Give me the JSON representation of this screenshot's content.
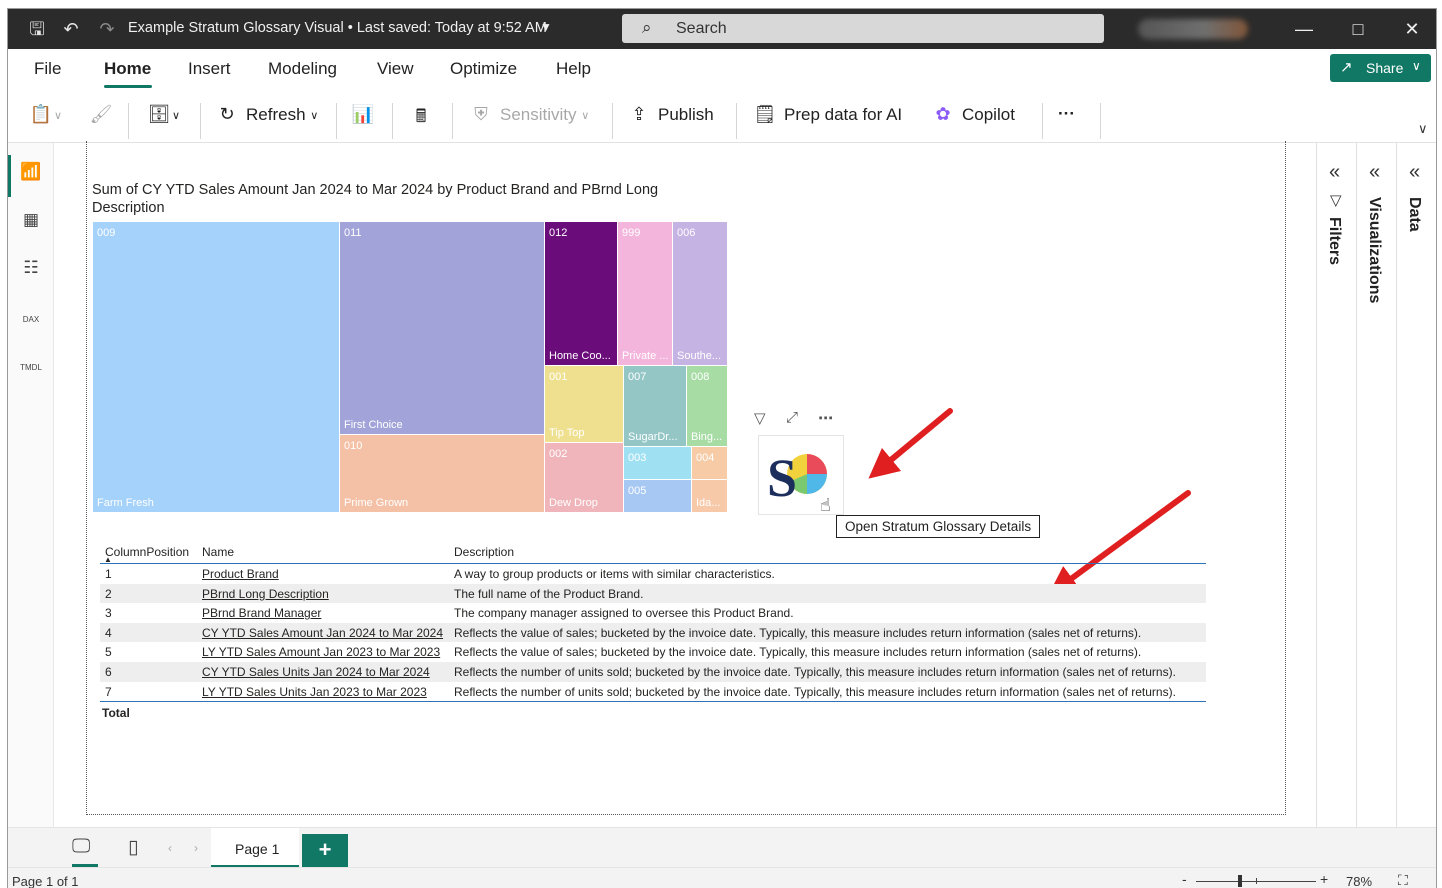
{
  "titlebar": {
    "title": "Example Stratum Glossary Visual  •  Last saved: Today at 9:52 AM",
    "search_label": "Search"
  },
  "menu": {
    "tabs": [
      "File",
      "Home",
      "Insert",
      "Modeling",
      "View",
      "Optimize",
      "Help"
    ],
    "active": "Home",
    "share_label": "Share"
  },
  "ribbon": {
    "refresh": "Refresh",
    "sensitivity": "Sensitivity",
    "publish": "Publish",
    "prep_data": "Prep data for AI",
    "copilot": "Copilot",
    "more": "···"
  },
  "leftnav": {
    "icons": [
      "report-view-icon",
      "table-view-icon",
      "model-view-icon",
      "dax-query-icon",
      "tmdl-view-icon"
    ],
    "dax_label": "DAX",
    "tmdl_label": "TMDL"
  },
  "visual": {
    "title": "Sum of CY YTD Sales Amount Jan 2024 to Mar 2024 by Product Brand and PBrnd Long Description"
  },
  "treemap": {
    "tiles": [
      {
        "code": "009",
        "name": "Farm Fresh",
        "color": "#a5d2fb"
      },
      {
        "code": "011",
        "name": "First Choice",
        "color": "#a2a4d9"
      },
      {
        "code": "010",
        "name": "Prime Grown",
        "color": "#f4c1a7"
      },
      {
        "code": "012",
        "name": "Home Coo...",
        "color": "#6a0c7a"
      },
      {
        "code": "999",
        "name": "Private ...",
        "color": "#f3b5dc"
      },
      {
        "code": "006",
        "name": "Southe...",
        "color": "#c5b3e3"
      },
      {
        "code": "001",
        "name": "Tip Top",
        "color": "#efe08f"
      },
      {
        "code": "007",
        "name": "SugarDr...",
        "color": "#94c6c6"
      },
      {
        "code": "008",
        "name": "Bing...",
        "color": "#a7dca5"
      },
      {
        "code": "002",
        "name": "Dew Drop",
        "color": "#f0b5ba"
      },
      {
        "code": "003",
        "name": "",
        "color": "#a0e0f3"
      },
      {
        "code": "004",
        "name": "",
        "color": "#f6cba6"
      },
      {
        "code": "005",
        "name": "",
        "color": "#a8c8f4"
      },
      {
        "code": "",
        "name": "Ida...",
        "color": "#f8c9a8"
      }
    ]
  },
  "image_visual": {
    "tooltip": "Open Stratum Glossary Details"
  },
  "table": {
    "headers": [
      "ColumnPosition",
      "Name",
      "Description"
    ],
    "rows": [
      {
        "pos": "1",
        "name": "Product Brand",
        "desc": "A way to group products or items with similar characteristics."
      },
      {
        "pos": "2",
        "name": "PBrnd Long Description",
        "desc": "The full name of the Product Brand."
      },
      {
        "pos": "3",
        "name": "PBrnd Brand Manager",
        "desc": "The company manager assigned to oversee this Product Brand."
      },
      {
        "pos": "4",
        "name": "CY YTD Sales Amount Jan 2024 to Mar 2024",
        "desc": "Reflects the value of sales; bucketed by the invoice date. Typically, this measure includes return information (sales net of returns)."
      },
      {
        "pos": "5",
        "name": "LY YTD Sales Amount Jan 2023 to Mar 2023",
        "desc": "Reflects the value of sales; bucketed by the invoice date. Typically, this measure includes return information (sales net of returns)."
      },
      {
        "pos": "6",
        "name": "CY YTD Sales Units Jan 2024 to Mar 2024",
        "desc": "Reflects the number of units sold; bucketed by the invoice date. Typically, this measure includes return information (sales net of returns)."
      },
      {
        "pos": "7",
        "name": "LY YTD Sales Units Jan 2023 to Mar 2023",
        "desc": "Reflects the number of units sold; bucketed by the invoice date. Typically, this measure includes return information (sales net of returns)."
      }
    ],
    "total_label": "Total"
  },
  "panes": {
    "filters": "Filters",
    "visualizations": "Visualizations",
    "data": "Data"
  },
  "pagetabs": {
    "page1": "Page 1",
    "add": "+"
  },
  "status": {
    "page_of": "Page 1 of 1",
    "zoom": "78%",
    "minus": "-",
    "plus": "+"
  },
  "colors": {
    "accent": "#117865",
    "titlebar": "#2b2b2b",
    "table_line": "#2e73b8",
    "arrow": "#e02020"
  }
}
